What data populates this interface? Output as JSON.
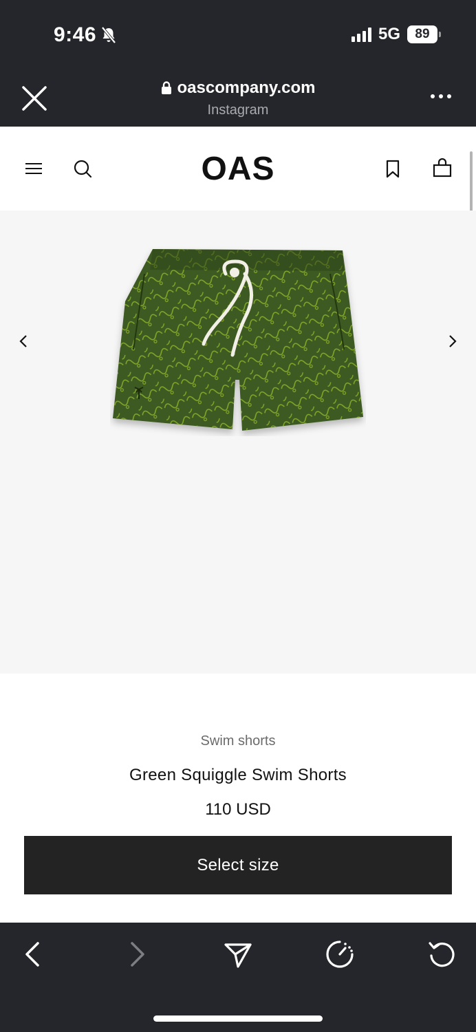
{
  "status_bar": {
    "time": "9:46",
    "network": "5G",
    "battery": "89"
  },
  "browser": {
    "url": "oascompany.com",
    "source": "Instagram"
  },
  "site": {
    "logo": "OAS"
  },
  "product": {
    "category": "Swim shorts",
    "title": "Green Squiggle Swim Shorts",
    "price": "110 USD",
    "select_size_label": "Select size",
    "colors": {
      "fabric": "#3e5a22",
      "pattern": "#8fb52c",
      "drawstring": "#f2efe6"
    }
  },
  "icons": {
    "close": "close-icon",
    "lock": "lock-icon",
    "more": "more-icon",
    "menu": "menu-icon",
    "search": "search-icon",
    "bookmark": "bookmark-icon",
    "bag": "bag-icon",
    "prev": "chevron-left-icon",
    "next": "chevron-right-icon",
    "back": "back-icon",
    "forward": "forward-icon",
    "share": "share-icon",
    "speed": "speed-icon",
    "reload": "reload-icon"
  }
}
